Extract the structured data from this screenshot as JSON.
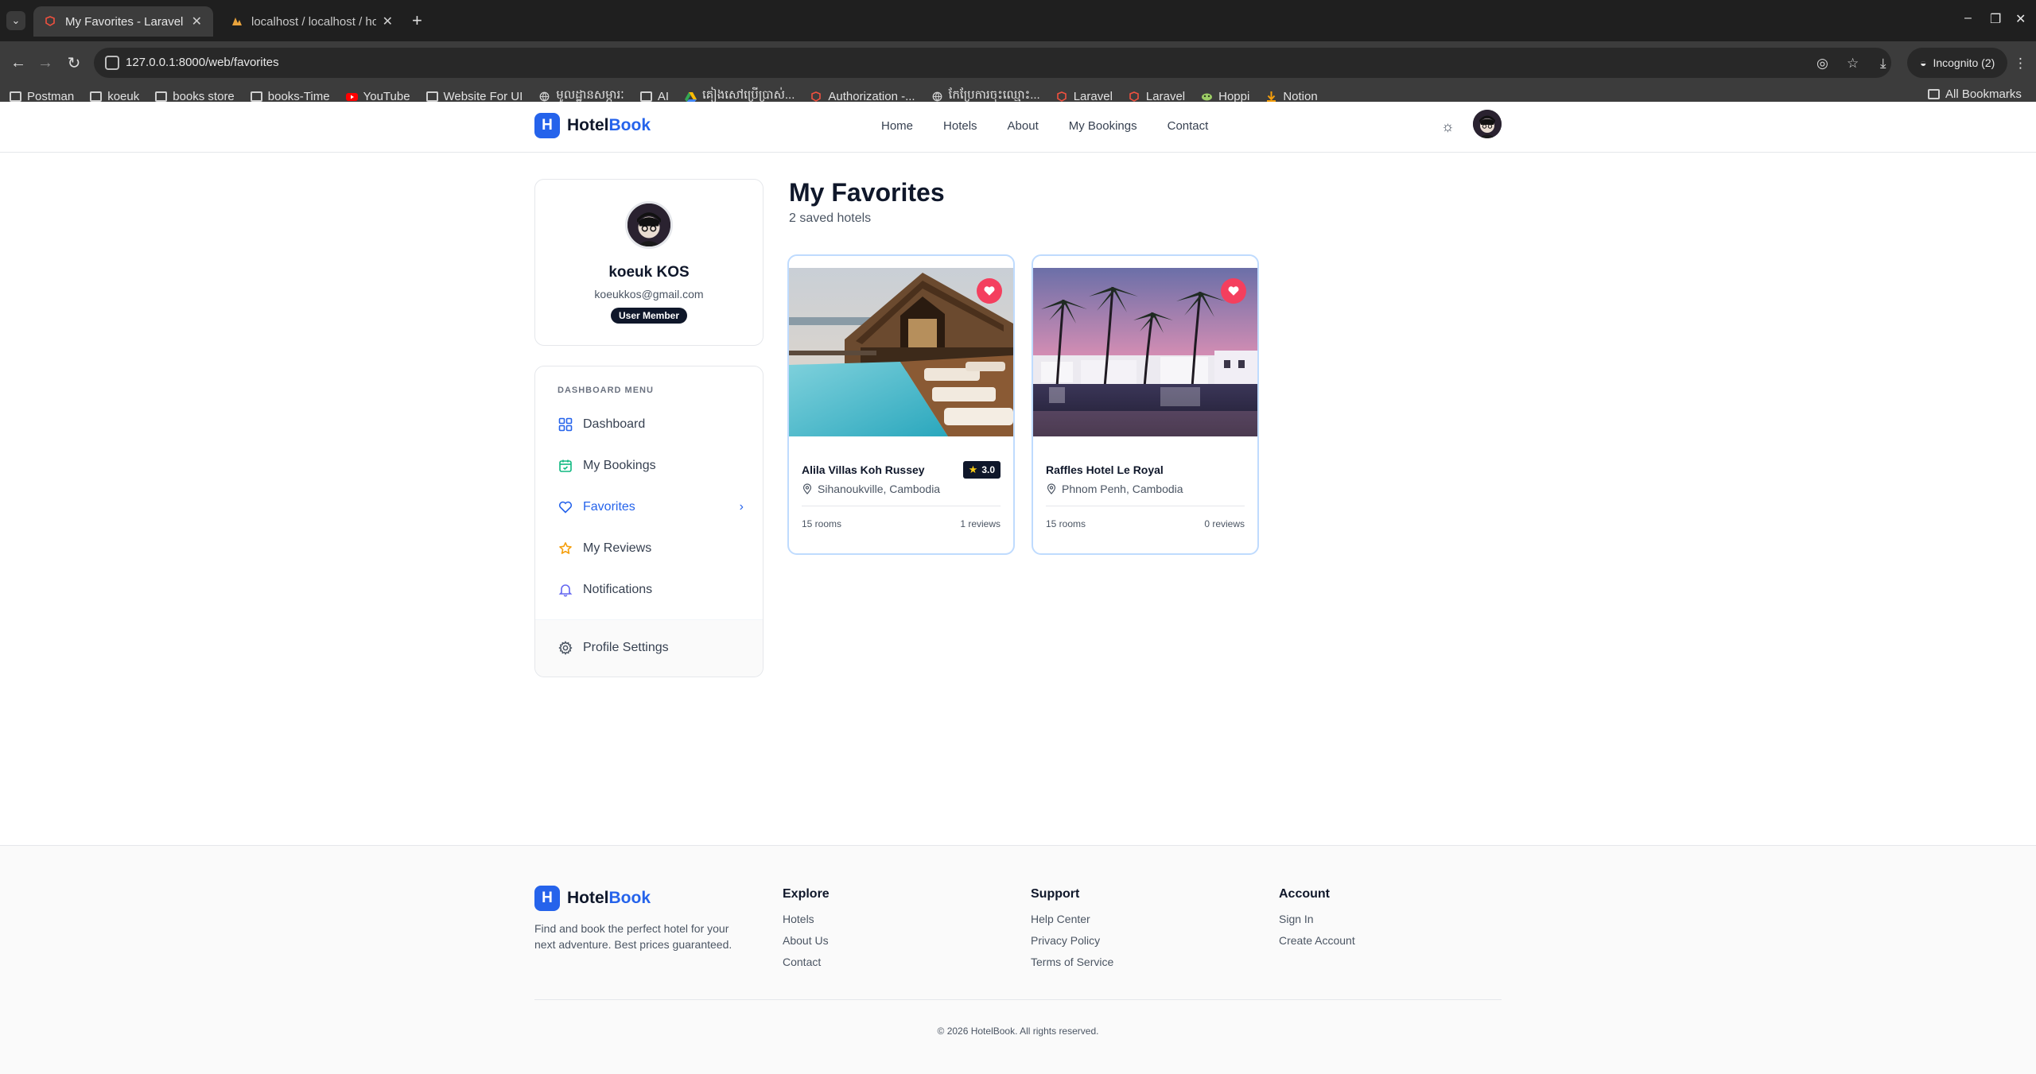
{
  "browser": {
    "tabs": [
      {
        "title": "My Favorites - Laravel",
        "active": true
      },
      {
        "title": "localhost / localhost / ho",
        "active": false
      }
    ],
    "url": "127.0.0.1:8000/web/favorites",
    "incognito_label": "Incognito (2)",
    "bookmarks": [
      {
        "label": "Postman",
        "icon": "folder-icon"
      },
      {
        "label": "koeuk",
        "icon": "folder-icon"
      },
      {
        "label": "books store",
        "icon": "folder-icon"
      },
      {
        "label": "books-Time",
        "icon": "folder-icon"
      },
      {
        "label": "YouTube",
        "icon": "youtube-icon"
      },
      {
        "label": "Website For UI",
        "icon": "folder-icon"
      },
      {
        "label": "មូលដ្ឋានសម្ភារៈ",
        "icon": "globe-icon"
      },
      {
        "label": "AI",
        "icon": "folder-icon"
      },
      {
        "label": "គៀងសៅប្រើប្រាស់...",
        "icon": "drive-icon"
      },
      {
        "label": "Authorization -...",
        "icon": "laravel-icon"
      },
      {
        "label": "កែប្រែការចុះឈ្មោះ...",
        "icon": "globe-icon"
      },
      {
        "label": "Laravel",
        "icon": "laravel-icon"
      },
      {
        "label": "Laravel",
        "icon": "laravel-icon"
      },
      {
        "label": "Hoppi",
        "icon": "hoppi-icon"
      },
      {
        "label": "Notion",
        "icon": "notion-icon"
      }
    ],
    "all_bookmarks": "All Bookmarks"
  },
  "header": {
    "logo_first": "Hotel",
    "logo_second": "Book",
    "logo_letter": "H",
    "nav": [
      "Home",
      "Hotels",
      "About",
      "My Bookings",
      "Contact"
    ]
  },
  "profile": {
    "name": "koeuk KOS",
    "email": "koeukkos@gmail.com",
    "badge": "User Member"
  },
  "menu": {
    "heading": "DASHBOARD MENU",
    "items": [
      {
        "label": "Dashboard",
        "icon": "grid-icon"
      },
      {
        "label": "My Bookings",
        "icon": "calendar-icon"
      },
      {
        "label": "Favorites",
        "icon": "heart-icon",
        "active": true
      },
      {
        "label": "My Reviews",
        "icon": "star-icon"
      },
      {
        "label": "Notifications",
        "icon": "bell-icon"
      }
    ],
    "settings_label": "Profile Settings"
  },
  "main": {
    "title": "My Favorites",
    "subtitle": "2 saved hotels",
    "hotels": [
      {
        "name": "Alila Villas Koh Russey",
        "rating": "3.0",
        "location": "Sihanoukville, Cambodia",
        "rooms": "15 rooms",
        "reviews": "1 reviews"
      },
      {
        "name": "Raffles Hotel Le Royal",
        "rating": "",
        "location": "Phnom Penh, Cambodia",
        "rooms": "15 rooms",
        "reviews": "0 reviews"
      }
    ]
  },
  "footer": {
    "description": "Find and book the perfect hotel for your next adventure. Best prices guaranteed.",
    "columns": [
      {
        "title": "Explore",
        "links": [
          "Hotels",
          "About Us",
          "Contact"
        ]
      },
      {
        "title": "Support",
        "links": [
          "Help Center",
          "Privacy Policy",
          "Terms of Service"
        ]
      },
      {
        "title": "Account",
        "links": [
          "Sign In",
          "Create Account"
        ]
      }
    ],
    "copyright": "© 2026 HotelBook. All rights reserved."
  },
  "colors": {
    "accent": "#2563eb",
    "heart": "#f43f5e",
    "dark": "#0f172a",
    "card_border": "#bfdbfe"
  }
}
